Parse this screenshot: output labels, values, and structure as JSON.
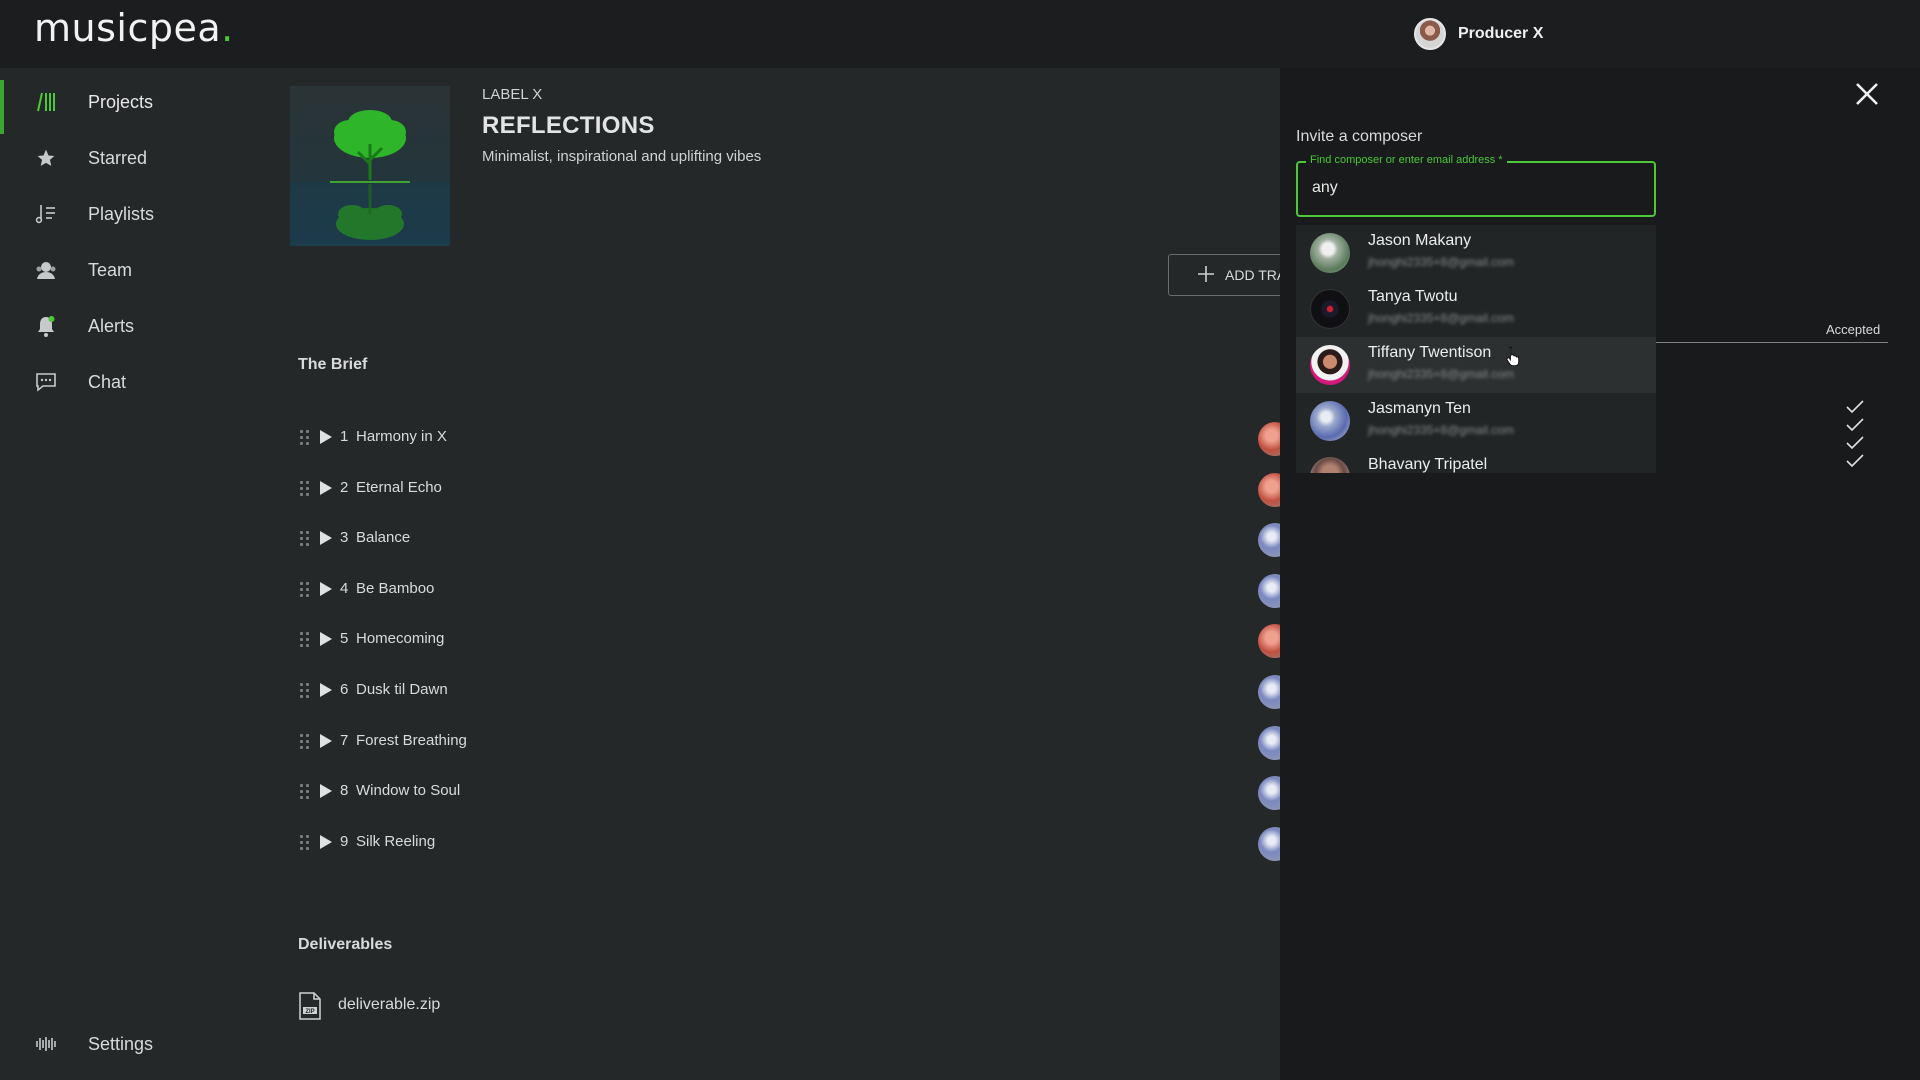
{
  "app": {
    "logo_text": "musicpea",
    "logo_dot": ".",
    "accent": "#4cc838"
  },
  "user": {
    "name": "Producer X"
  },
  "sidebar": {
    "items": [
      {
        "label": "Projects",
        "icon": "projects-bars-icon",
        "active": true
      },
      {
        "label": "Starred",
        "icon": "star-icon"
      },
      {
        "label": "Playlists",
        "icon": "playlist-icon"
      },
      {
        "label": "Team",
        "icon": "team-icon"
      },
      {
        "label": "Alerts",
        "icon": "bell-icon"
      },
      {
        "label": "Chat",
        "icon": "chat-icon"
      }
    ],
    "settings": {
      "label": "Settings",
      "icon": "waveform-icon"
    }
  },
  "project": {
    "label": "LABEL X",
    "title": "REFLECTIONS",
    "description": "Minimalist, inspirational and uplifting vibes",
    "add_track_label": "ADD TRACK"
  },
  "brief": {
    "title": "The Brief",
    "tracks": [
      {
        "num": "1",
        "name": "Harmony in X"
      },
      {
        "num": "2",
        "name": "Eternal Echo"
      },
      {
        "num": "3",
        "name": "Balance"
      },
      {
        "num": "4",
        "name": "Be Bamboo"
      },
      {
        "num": "5",
        "name": "Homecoming"
      },
      {
        "num": "6",
        "name": "Dusk til Dawn"
      },
      {
        "num": "7",
        "name": "Forest Breathing"
      },
      {
        "num": "8",
        "name": "Window to Soul"
      },
      {
        "num": "9",
        "name": "Silk Reeling"
      }
    ]
  },
  "deliverables": {
    "title": "Deliverables",
    "files": [
      {
        "name": "deliverable.zip",
        "icon": "zip-file-icon"
      }
    ]
  },
  "invite": {
    "title": "Invite a composer",
    "field_label": "Find composer or enter email address *",
    "value": "any",
    "options": [
      {
        "name": "Jason Makany",
        "email": "jhonghi2335+8@gmail.com"
      },
      {
        "name": "Tanya Twotu",
        "email": "jhonghi2335+8@gmail.com"
      },
      {
        "name": "Tiffany Twentison",
        "email": "jhonghi2335+8@gmail.com"
      },
      {
        "name": "Jasmanyn Ten",
        "email": "jhonghi2335+8@gmail.com"
      },
      {
        "name": "Bhavany Tripatel",
        "email": ""
      }
    ],
    "accepted_label": "Accepted"
  }
}
